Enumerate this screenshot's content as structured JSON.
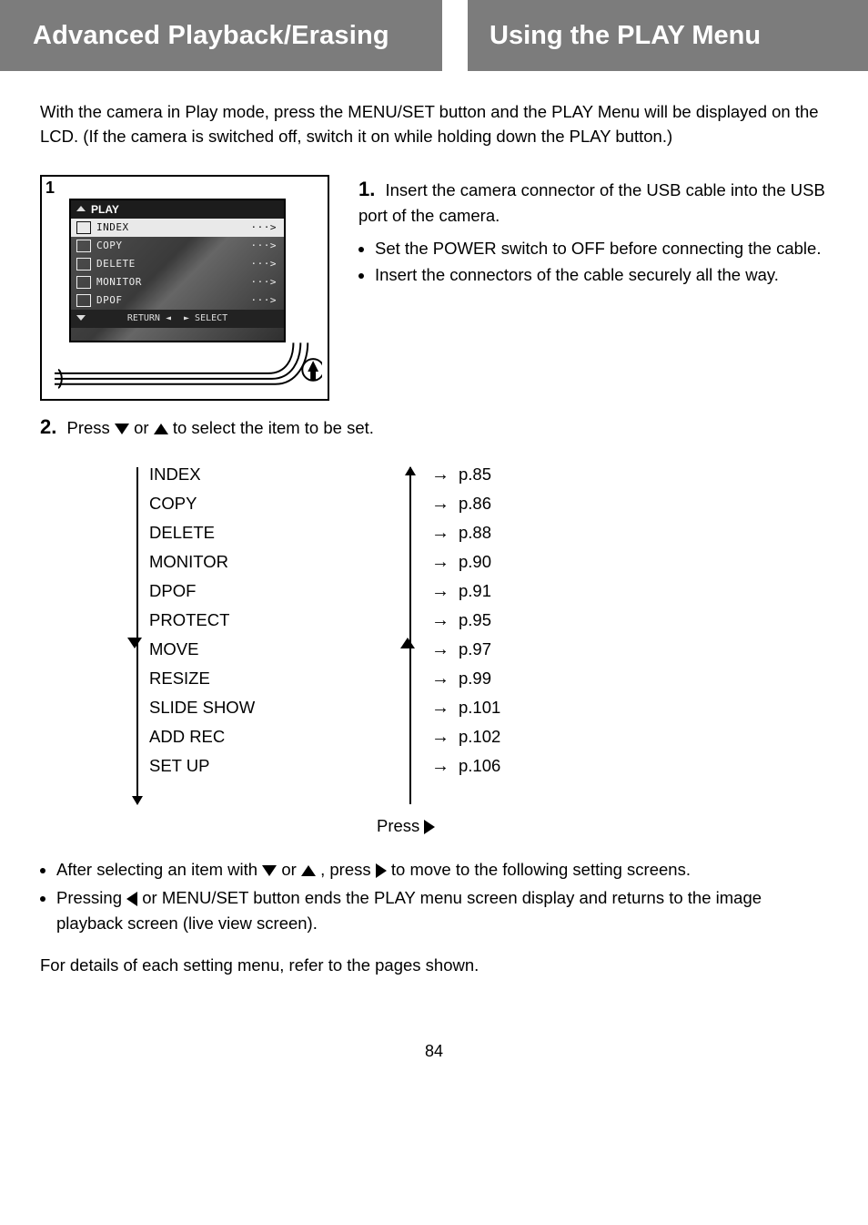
{
  "header": {
    "left": "Advanced Playback/Erasing",
    "right": "Using the PLAY Menu"
  },
  "intro": "With the camera in Play mode, press the MENU/SET button and the PLAY Menu will be displayed on the LCD. (If the camera is switched off, switch it on while holding down the PLAY button.)",
  "screenshot": {
    "step": "1",
    "title": "PLAY",
    "rows": [
      {
        "label": "INDEX",
        "selected": true
      },
      {
        "label": "COPY",
        "selected": false
      },
      {
        "label": "DELETE",
        "selected": false
      },
      {
        "label": "MONITOR",
        "selected": false
      },
      {
        "label": "DPOF",
        "selected": false
      }
    ],
    "footer_left": "RETURN",
    "footer_right": "SELECT"
  },
  "step1": {
    "num": "1.",
    "text": "Insert the camera connector of the USB cable into the USB port of the camera.",
    "bullets": [
      "Set the POWER switch to OFF before connecting the cable.",
      "Insert the connectors of the cable securely all the way."
    ]
  },
  "step2": {
    "num": "2.",
    "lead_a": "Press ",
    "lead_b": " or ",
    "lead_c": " to select the item to be set."
  },
  "flow": {
    "left": [
      "INDEX",
      "COPY",
      "DELETE",
      "MONITOR",
      "DPOF",
      "PROTECT",
      "MOVE",
      "RESIZE",
      "SLIDE SHOW",
      "ADD REC",
      "SET UP"
    ],
    "right": [
      "p.85",
      "p.86",
      "p.88",
      "p.90",
      "p.91",
      "p.95",
      "p.97",
      "p.99",
      "p.101",
      "p.102",
      "p.106"
    ],
    "press_right": "Press "
  },
  "after": {
    "bullet1_a": "After selecting an item with ",
    "bullet1_b": " or ",
    "bullet1_c": ", press ",
    "bullet1_d": " to move to the following setting screens.",
    "bullet2_a": "Pressing ",
    "bullet2_b": " or MENU/SET button ends the PLAY menu screen display and returns to the image playback screen (live view screen)."
  },
  "closing": "For details of each setting menu, refer to the pages shown.",
  "page_number": "84"
}
